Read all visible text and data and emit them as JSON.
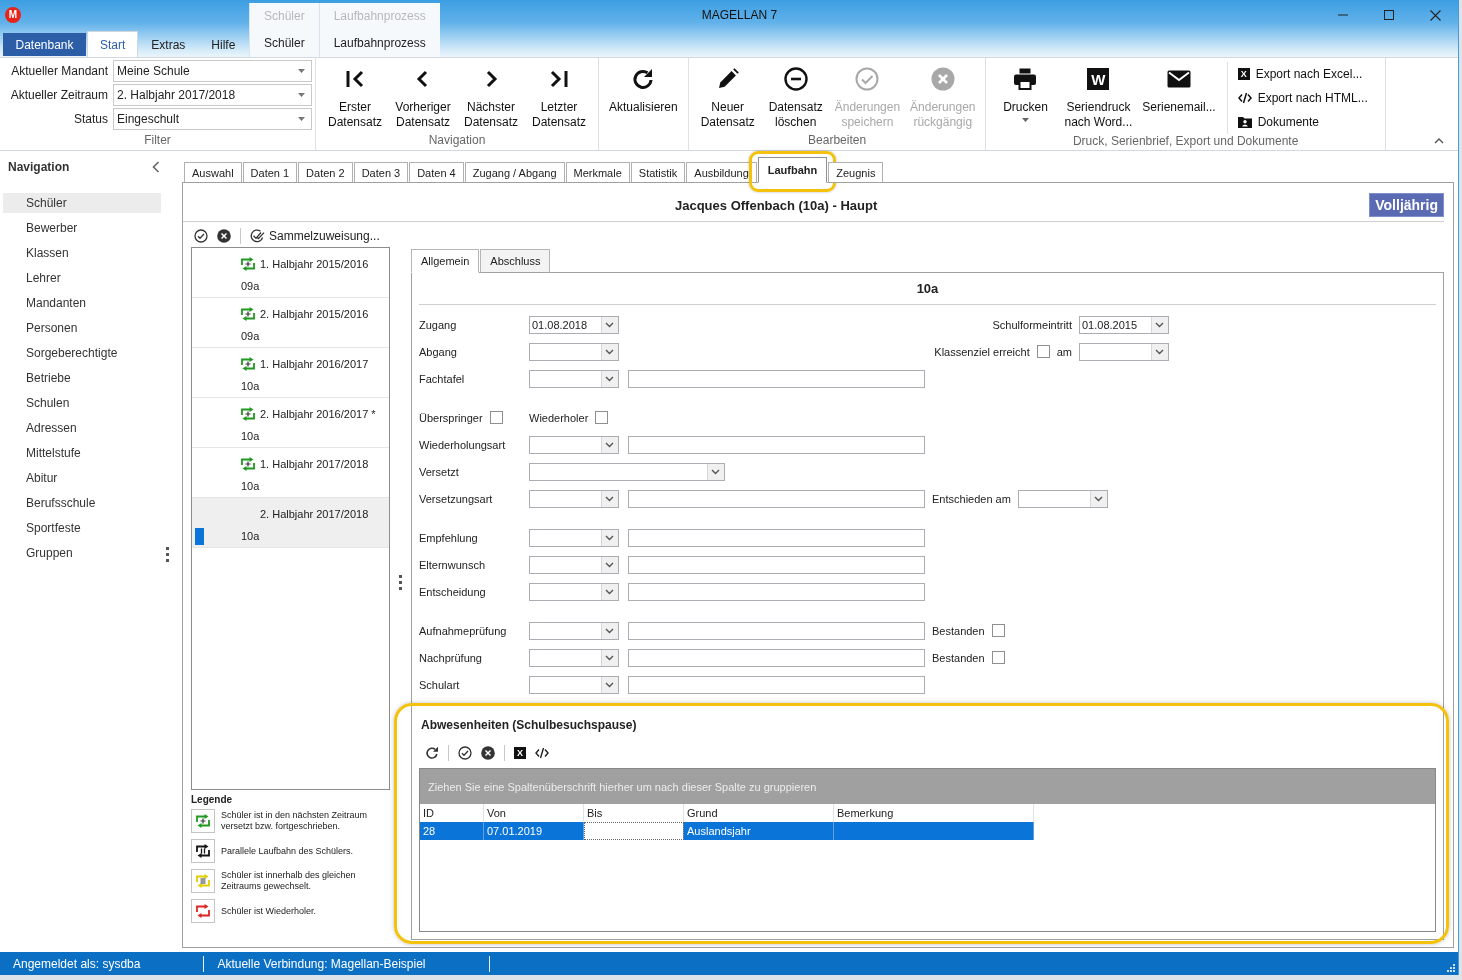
{
  "window": {
    "logo": "M",
    "title": "MAGELLAN 7"
  },
  "ribbon_tabs": [
    {
      "kind": "file",
      "label": "Datenbank",
      "selected": false
    },
    {
      "kind": "tab",
      "label": "Start",
      "selected": true
    },
    {
      "kind": "tab",
      "label": "Extras",
      "selected": false
    },
    {
      "kind": "tab",
      "label": "Hilfe",
      "selected": false
    },
    {
      "kind": "context",
      "group": "Schüler",
      "label": "Schüler",
      "selected": false
    },
    {
      "kind": "context",
      "group": "Laufbahnprozess",
      "label": "Laufbahnprozess",
      "selected": false
    }
  ],
  "ribbon_groups": [
    {
      "kind": "filter",
      "label": "Filter",
      "fields": [
        {
          "label": "Aktueller Mandant",
          "value": "Meine Schule"
        },
        {
          "label": "Aktueller Zeitraum",
          "value": "2. Halbjahr 2017/2018"
        },
        {
          "label": "Status",
          "value": "Eingeschult"
        }
      ]
    },
    {
      "kind": "buttons",
      "label": "Navigation",
      "buttons": [
        {
          "kind": "first",
          "lines": [
            "Erster",
            "Datensatz"
          ],
          "disabled": false,
          "dropdown": false
        },
        {
          "kind": "previous",
          "lines": [
            "Vorheriger",
            "Datensatz"
          ],
          "disabled": false,
          "dropdown": false
        },
        {
          "kind": "next",
          "lines": [
            "Nächster",
            "Datensatz"
          ],
          "disabled": false,
          "dropdown": false
        },
        {
          "kind": "last",
          "lines": [
            "Letzter",
            "Datensatz"
          ],
          "disabled": false,
          "dropdown": false
        }
      ]
    },
    {
      "kind": "buttons",
      "buttons": [
        {
          "kind": "refresh",
          "lines": [
            "Aktualisieren"
          ],
          "disabled": false,
          "dropdown": false
        }
      ]
    },
    {
      "kind": "buttons",
      "label": "Bearbeiten",
      "buttons": [
        {
          "kind": "new",
          "lines": [
            "Neuer",
            "Datensatz"
          ],
          "disabled": false,
          "dropdown": false
        },
        {
          "kind": "delete",
          "lines": [
            "Datensatz",
            "löschen"
          ],
          "disabled": false,
          "dropdown": false
        },
        {
          "kind": "save",
          "lines": [
            "Änderungen",
            "speichern"
          ],
          "disabled": true,
          "dropdown": false
        },
        {
          "kind": "undo",
          "lines": [
            "Änderungen",
            "rückgängig"
          ],
          "disabled": true,
          "dropdown": false
        }
      ]
    },
    {
      "kind": "buttons",
      "label": "Druck, Serienbrief, Export und Dokumente",
      "buttons": [
        {
          "kind": "print",
          "lines": [
            "Drucken"
          ],
          "disabled": false,
          "dropdown": true
        },
        {
          "kind": "word",
          "icon_text": "W",
          "lines": [
            "Seriendruck",
            "nach Word..."
          ],
          "disabled": false,
          "dropdown": false
        },
        {
          "kind": "email",
          "lines": [
            "Serienemail..."
          ],
          "disabled": false,
          "dropdown": false
        }
      ],
      "links": [
        {
          "kind": "excel",
          "icon_text": "X",
          "label": "Export nach Excel..."
        },
        {
          "kind": "html",
          "label": "Export nach HTML..."
        },
        {
          "kind": "documents",
          "label": "Dokumente"
        }
      ]
    }
  ],
  "navigation": {
    "title": "Navigation",
    "items": [
      {
        "label": "Schüler",
        "selected": true
      },
      {
        "label": "Bewerber",
        "selected": false
      },
      {
        "label": "Klassen",
        "selected": false
      },
      {
        "label": "Lehrer",
        "selected": false
      },
      {
        "label": "Mandanten",
        "selected": false
      },
      {
        "label": "Personen",
        "selected": false
      },
      {
        "label": "Sorgeberechtigte",
        "selected": false
      },
      {
        "label": "Betriebe",
        "selected": false
      },
      {
        "label": "Schulen",
        "selected": false
      },
      {
        "label": "Adressen",
        "selected": false
      },
      {
        "label": "Mittelstufe",
        "selected": false
      },
      {
        "label": "Abitur",
        "selected": false
      },
      {
        "label": "Berufsschule",
        "selected": false
      },
      {
        "label": "Sportfeste",
        "selected": false
      },
      {
        "label": "Gruppen",
        "selected": false
      }
    ]
  },
  "record_tabs": [
    {
      "label": "Auswahl",
      "selected": false,
      "highlighted": false
    },
    {
      "label": "Daten 1",
      "selected": false,
      "highlighted": false
    },
    {
      "label": "Daten 2",
      "selected": false,
      "highlighted": false
    },
    {
      "label": "Daten 3",
      "selected": false,
      "highlighted": false
    },
    {
      "label": "Daten 4",
      "selected": false,
      "highlighted": false
    },
    {
      "label": "Zugang / Abgang",
      "selected": false,
      "highlighted": false
    },
    {
      "label": "Merkmale",
      "selected": false,
      "highlighted": false
    },
    {
      "label": "Statistik",
      "selected": false,
      "highlighted": false
    },
    {
      "label": "Ausbildung",
      "selected": false,
      "highlighted": false
    },
    {
      "label": "Laufbahn",
      "selected": true,
      "highlighted": true
    },
    {
      "label": "Zeugnis",
      "selected": false,
      "highlighted": false
    }
  ],
  "record": {
    "title": "Jacques Offenbach (10a) - Haupt",
    "badge": "Volljährig"
  },
  "periods": {
    "action": "Sammelzuweisung...",
    "items": [
      {
        "kind": "promoted",
        "title": "1. Halbjahr 2015/2016",
        "class": "09a",
        "selected": false
      },
      {
        "kind": "promoted",
        "title": "2. Halbjahr 2015/2016",
        "class": "09a",
        "selected": false
      },
      {
        "kind": "promoted",
        "title": "1. Halbjahr 2016/2017",
        "class": "10a",
        "selected": false
      },
      {
        "kind": "promoted",
        "title": "2. Halbjahr 2016/2017 *",
        "class": "10a",
        "selected": false
      },
      {
        "kind": "promoted",
        "title": "1. Halbjahr 2017/2018",
        "class": "10a",
        "selected": false
      },
      {
        "kind": "current",
        "title": "2. Halbjahr 2017/2018",
        "class": "10a",
        "selected": true
      }
    ]
  },
  "legend": {
    "title": "Legende",
    "items": [
      {
        "kind": "promoted",
        "text": "Schüler ist in den nächsten Zeitraum versetzt bzw. fortgeschrieben."
      },
      {
        "kind": "parallel",
        "text": "Parallele Laufbahn des Schülers."
      },
      {
        "kind": "changed",
        "text": "Schüler ist innerhalb des gleichen Zeitraums gewechselt."
      },
      {
        "kind": "repeated",
        "text": "Schüler ist Wiederholer."
      }
    ]
  },
  "detail_tabs": [
    {
      "label": "Allgemein",
      "selected": true
    },
    {
      "label": "Abschluss",
      "selected": false
    }
  ],
  "form": {
    "heading": "10a",
    "sections": [
      {
        "rows": [
          {
            "label": "Zugang",
            "items": [
              {
                "kind": "combo",
                "value": "01.08.2018"
              }
            ],
            "right": [
              {
                "kind": "label",
                "text": "Schulformeintritt"
              },
              {
                "kind": "combo",
                "value": "01.08.2015"
              }
            ]
          },
          {
            "label": "Abgang",
            "items": [
              {
                "kind": "combo"
              }
            ],
            "right": [
              {
                "kind": "checkbox",
                "label": "Klassenziel erreicht",
                "checked": false
              },
              {
                "kind": "label",
                "text": "am"
              },
              {
                "kind": "combo"
              }
            ]
          },
          {
            "label": "Fachtafel",
            "items": [
              {
                "kind": "combo"
              },
              {
                "kind": "text"
              }
            ]
          }
        ]
      },
      {
        "rows": [
          {
            "items": [
              {
                "kind": "checkbox",
                "label": "Überspringer",
                "checked": false
              },
              {
                "kind": "checkbox",
                "label": "Wiederholer",
                "checked": false
              }
            ]
          },
          {
            "label": "Wiederholungsart",
            "items": [
              {
                "kind": "combo"
              },
              {
                "kind": "text"
              }
            ]
          },
          {
            "label": "Versetzt",
            "items": [
              {
                "kind": "longcombo"
              }
            ]
          },
          {
            "label": "Versetzungsart",
            "items": [
              {
                "kind": "combo"
              },
              {
                "kind": "text"
              }
            ],
            "right": [
              {
                "kind": "label",
                "text": "Entschieden am"
              },
              {
                "kind": "combo"
              }
            ]
          }
        ]
      },
      {
        "rows": [
          {
            "label": "Empfehlung",
            "items": [
              {
                "kind": "combo"
              },
              {
                "kind": "text"
              }
            ]
          },
          {
            "label": "Elternwunsch",
            "items": [
              {
                "kind": "combo"
              },
              {
                "kind": "text"
              }
            ]
          },
          {
            "label": "Entscheidung",
            "items": [
              {
                "kind": "combo"
              },
              {
                "kind": "text"
              }
            ]
          }
        ]
      },
      {
        "rows": [
          {
            "label": "Aufnahmeprüfung",
            "items": [
              {
                "kind": "combo"
              },
              {
                "kind": "text"
              }
            ],
            "right": [
              {
                "kind": "checkbox",
                "label": "Bestanden",
                "checked": false
              }
            ]
          },
          {
            "label": "Nachprüfung",
            "items": [
              {
                "kind": "combo"
              },
              {
                "kind": "text"
              }
            ],
            "right": [
              {
                "kind": "checkbox",
                "label": "Bestanden",
                "checked": false
              }
            ]
          },
          {
            "label": "Schulart",
            "items": [
              {
                "kind": "combo"
              },
              {
                "kind": "text"
              }
            ]
          }
        ]
      }
    ]
  },
  "absences": {
    "title": "Abwesenheiten (Schulbesuchspause)",
    "highlighted": true,
    "excel_icon_text": "X",
    "group_hint": "Ziehen Sie eine Spaltenüberschrift hierher um nach dieser Spalte zu gruppieren",
    "columns": [
      "ID",
      "Von",
      "Bis",
      "Grund",
      "Bemerkung"
    ],
    "rows": [
      {
        "selected": true,
        "cells": [
          {
            "value": "28",
            "focused": false
          },
          {
            "value": "07.01.2019",
            "focused": false
          },
          {
            "focused": true
          },
          {
            "value": "Auslandsjahr",
            "focused": false
          },
          {
            "focused": false
          }
        ]
      }
    ]
  },
  "status_bar": [
    "Angemeldet als: sysdba",
    "Aktuelle Verbindung: Magellan-Beispiel"
  ]
}
